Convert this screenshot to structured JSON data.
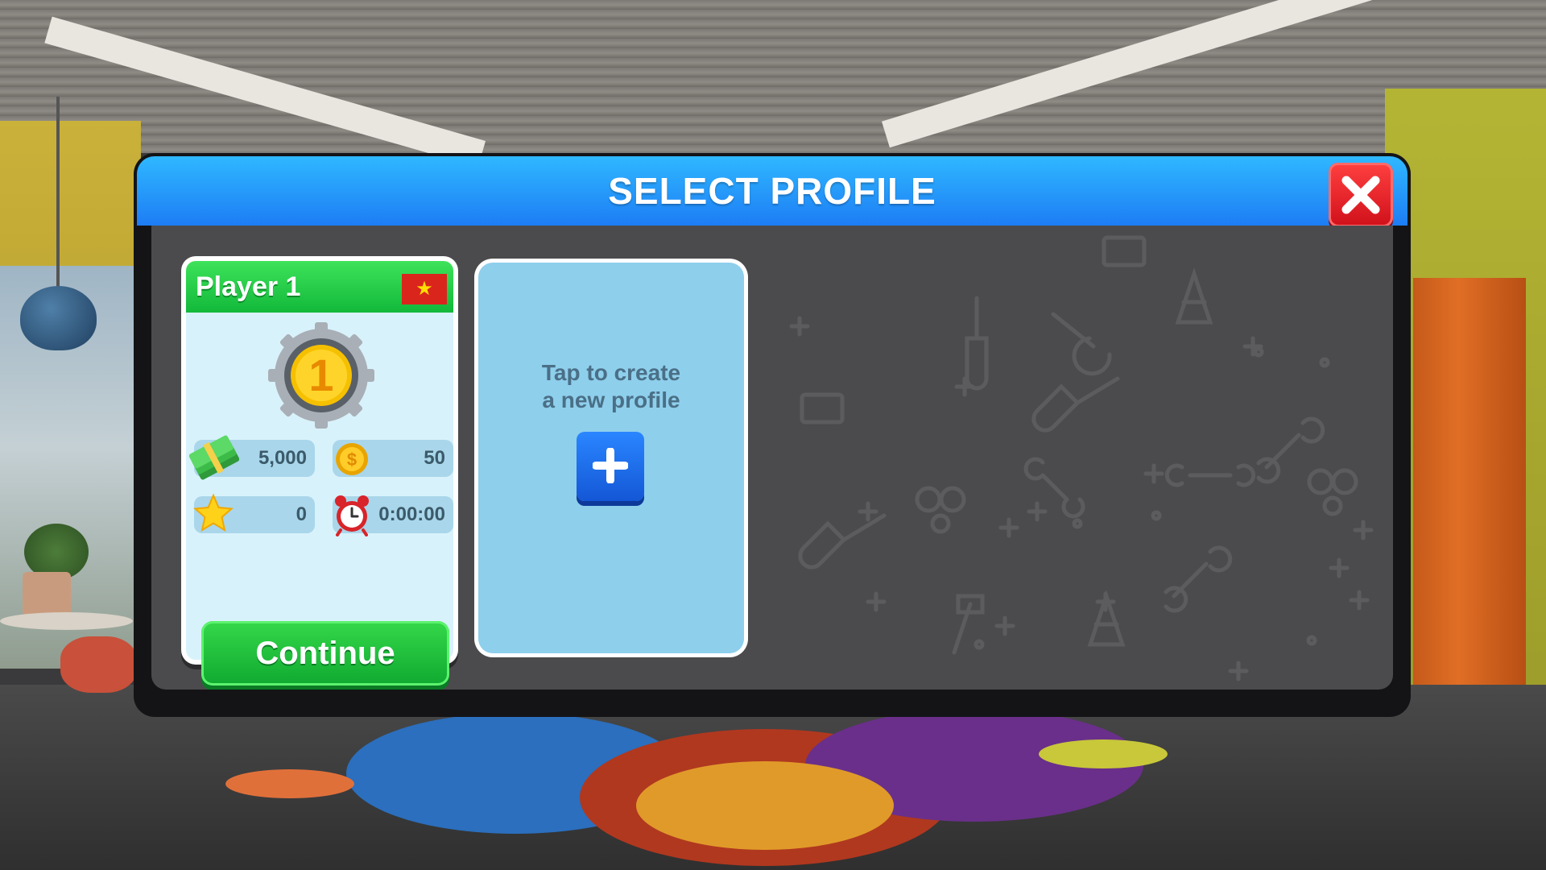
{
  "dialog": {
    "title": "SELECT PROFILE"
  },
  "profile": {
    "name": "Player 1",
    "flag": "Vietnam flag",
    "level": "1",
    "stats": {
      "cash": "5,000",
      "coins": "50",
      "stars": "0",
      "playtime": "0:00:00"
    },
    "continue_label": "Continue"
  },
  "new_profile": {
    "line1": "Tap to create",
    "line2": "a new profile"
  },
  "colors": {
    "header_blue": "#1d7df5",
    "close_red": "#d0101a",
    "card_green": "#12b83a",
    "new_card_blue": "#8ecfec",
    "add_button_blue": "#1457d6"
  },
  "icons": [
    "close-icon",
    "cash-icon",
    "coin-icon",
    "star-icon",
    "alarm-clock-icon",
    "plus-icon",
    "level-gear-icon"
  ]
}
